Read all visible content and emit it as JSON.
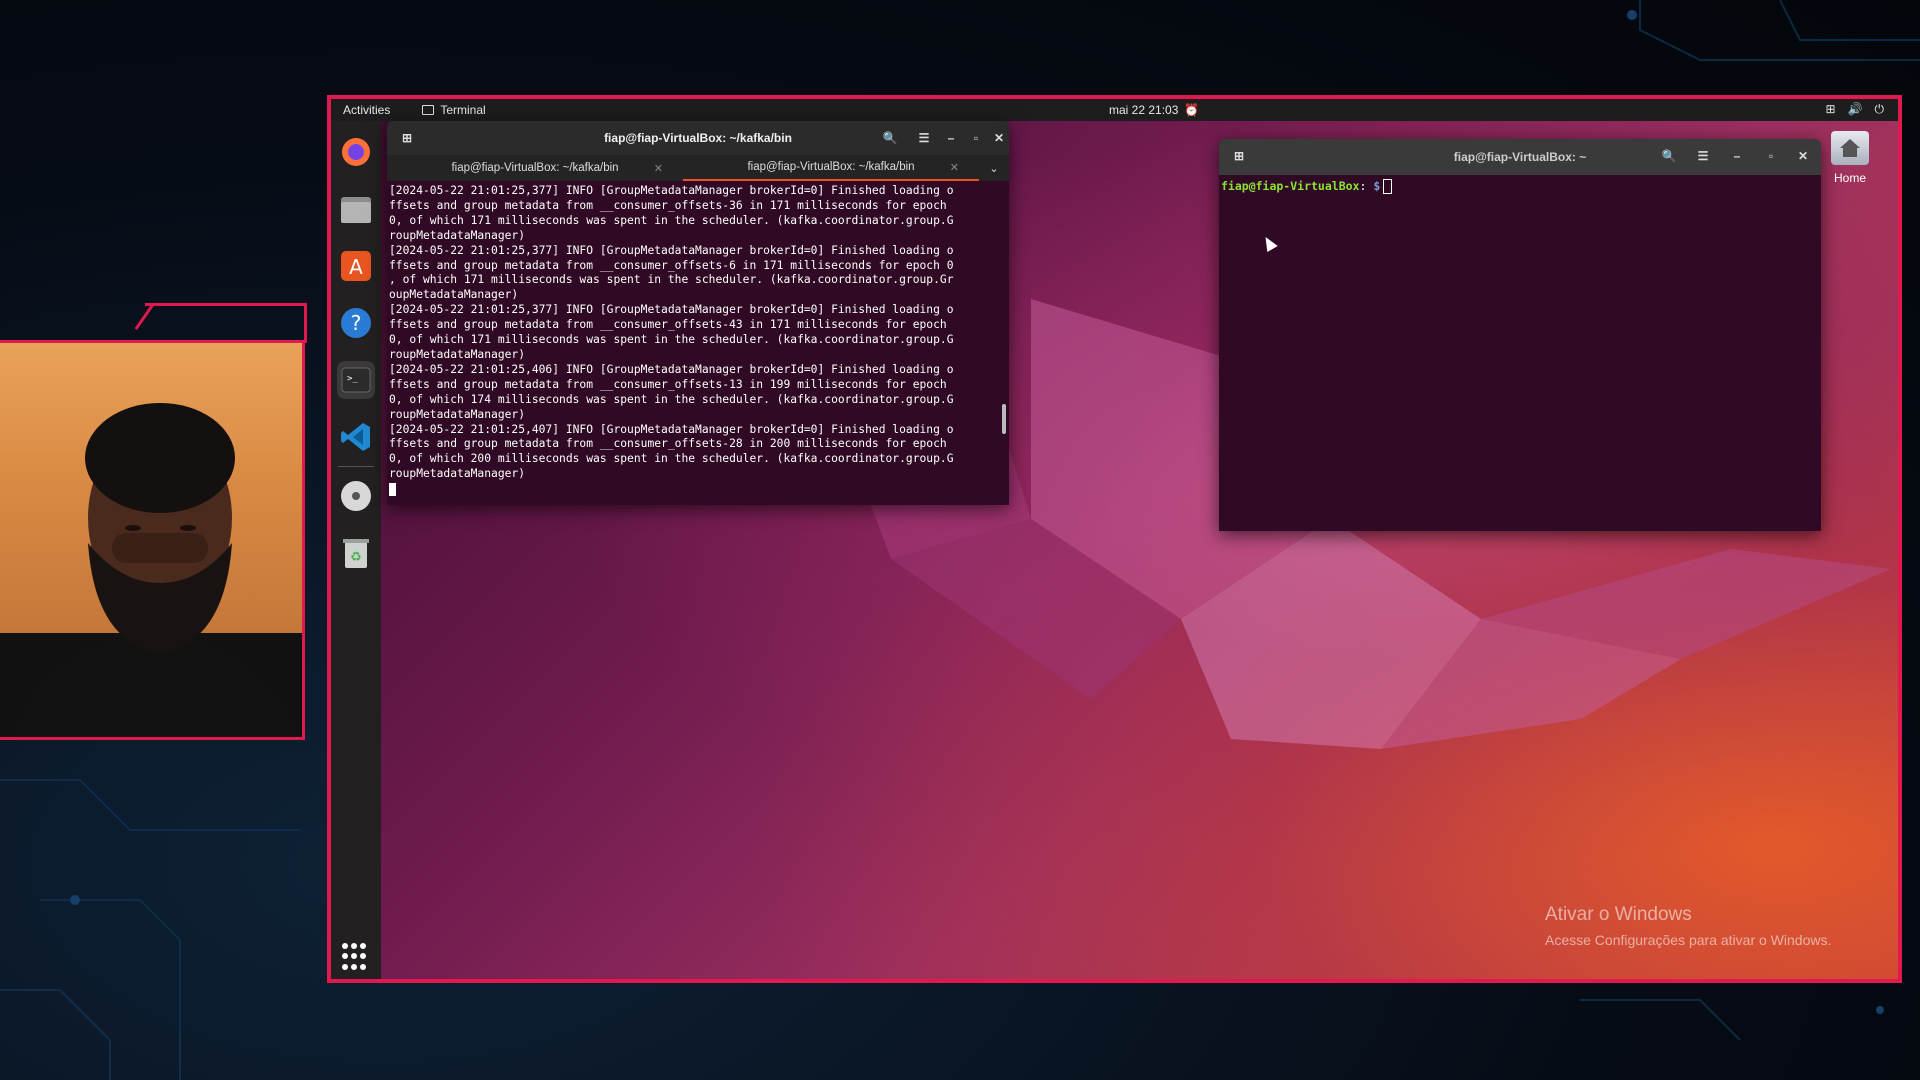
{
  "topbar": {
    "activities": "Activities",
    "app_name": "Terminal",
    "clock": "mai 22  21:03"
  },
  "dock": {
    "items": [
      "firefox-icon",
      "files-icon",
      "app-center-icon",
      "help-icon",
      "terminal-icon",
      "vscode-icon",
      "dvd-icon",
      "trash-icon"
    ]
  },
  "main_terminal": {
    "title": "fiap@fiap-VirtualBox: ~/kafka/bin",
    "tabs": [
      {
        "label": "fiap@fiap-VirtualBox: ~/kafka/bin",
        "active": false
      },
      {
        "label": "fiap@fiap-VirtualBox: ~/kafka/bin",
        "active": true
      }
    ],
    "log_lines": [
      "[2024-05-22 21:01:25,377] INFO [GroupMetadataManager brokerId=0] Finished loading o",
      "ffsets and group metadata from __consumer_offsets-36 in 171 milliseconds for epoch",
      "0, of which 171 milliseconds was spent in the scheduler. (kafka.coordinator.group.G",
      "roupMetadataManager)",
      "[2024-05-22 21:01:25,377] INFO [GroupMetadataManager brokerId=0] Finished loading o",
      "ffsets and group metadata from __consumer_offsets-6 in 171 milliseconds for epoch 0",
      ", of which 171 milliseconds was spent in the scheduler. (kafka.coordinator.group.Gr",
      "oupMetadataManager)",
      "[2024-05-22 21:01:25,377] INFO [GroupMetadataManager brokerId=0] Finished loading o",
      "ffsets and group metadata from __consumer_offsets-43 in 171 milliseconds for epoch",
      "0, of which 171 milliseconds was spent in the scheduler. (kafka.coordinator.group.G",
      "roupMetadataManager)",
      "[2024-05-22 21:01:25,406] INFO [GroupMetadataManager brokerId=0] Finished loading o",
      "ffsets and group metadata from __consumer_offsets-13 in 199 milliseconds for epoch",
      "0, of which 174 milliseconds was spent in the scheduler. (kafka.coordinator.group.G",
      "roupMetadataManager)",
      "[2024-05-22 21:01:25,407] INFO [GroupMetadataManager brokerId=0] Finished loading o",
      "ffsets and group metadata from __consumer_offsets-28 in 200 milliseconds for epoch",
      "0, of which 200 milliseconds was spent in the scheduler. (kafka.coordinator.group.G",
      "roupMetadataManager)"
    ]
  },
  "second_terminal": {
    "title": "fiap@fiap-VirtualBox: ~",
    "prompt_user": "fiap@fiap-VirtualBox",
    "prompt_sep": ":",
    "prompt_path": " $"
  },
  "desktop": {
    "home_label": "Home"
  },
  "watermark": {
    "line1": "Ativar o Windows",
    "line2": "Acesse Configurações para ativar o Windows."
  },
  "colors": {
    "frame_accent": "#e0194f",
    "ubuntu_orange": "#e95420",
    "terminal_bg": "#300a24"
  }
}
